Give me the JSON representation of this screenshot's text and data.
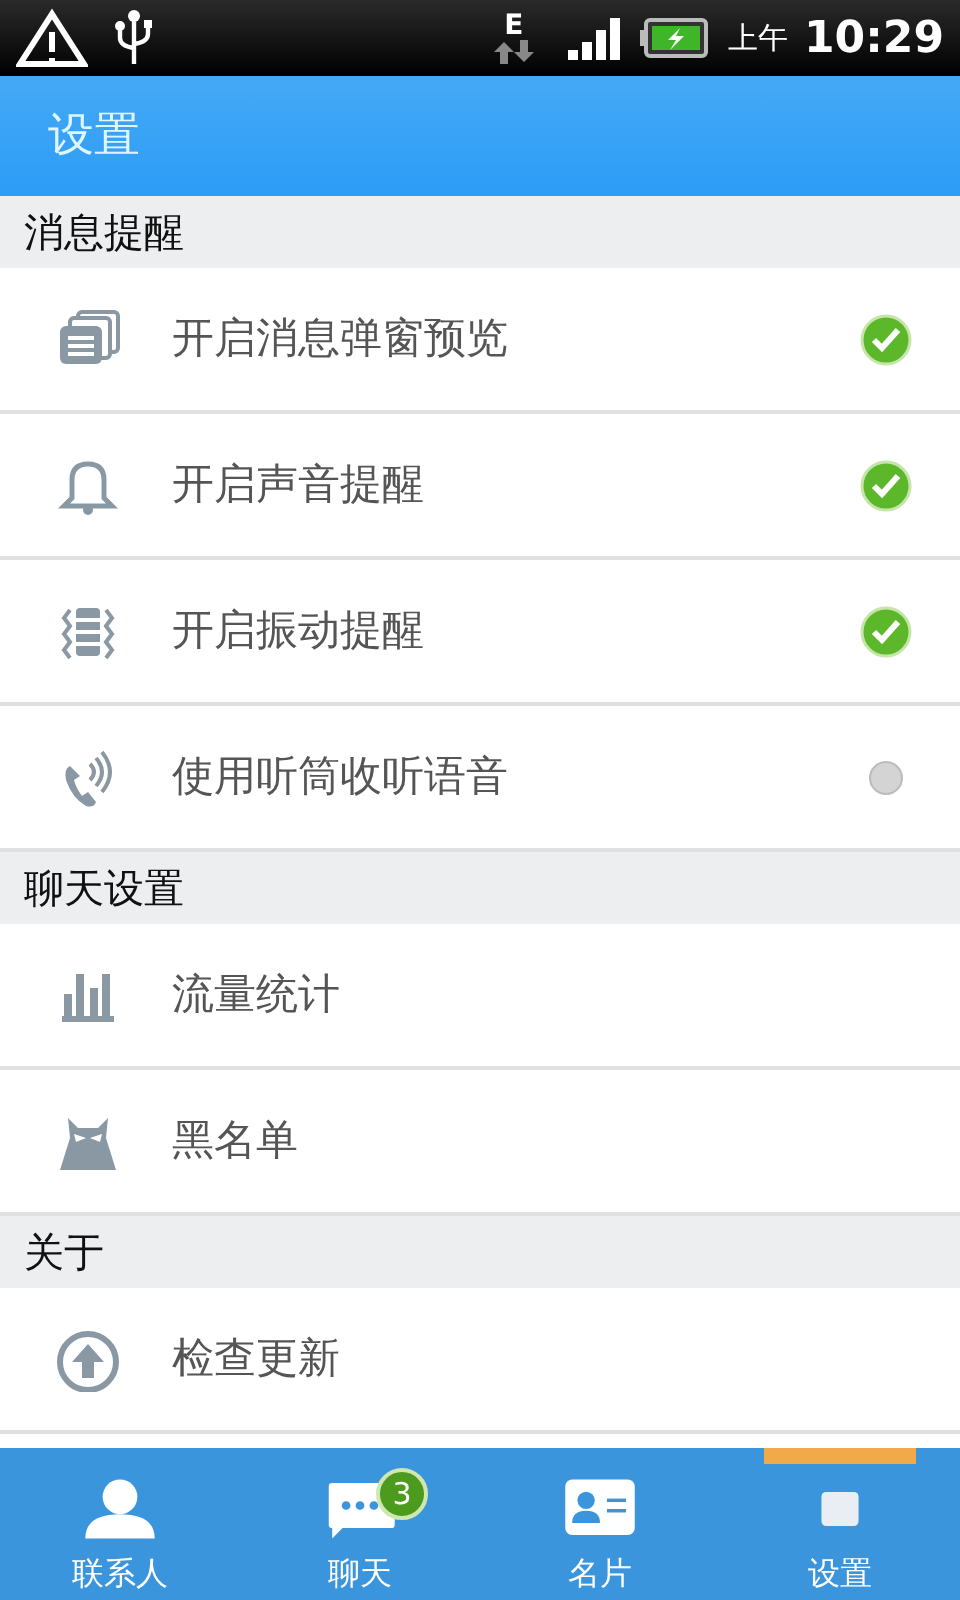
{
  "status_bar": {
    "network": "E",
    "am_pm": "上午",
    "time": "10:29"
  },
  "title_bar": {
    "title": "设置"
  },
  "sections": [
    {
      "header": "消息提醒",
      "items": [
        {
          "label": "开启消息弹窗预览",
          "kind": "toggle",
          "checked": true
        },
        {
          "label": "开启声音提醒",
          "kind": "toggle",
          "checked": true
        },
        {
          "label": "开启振动提醒",
          "kind": "toggle",
          "checked": true
        },
        {
          "label": "使用听筒收听语音",
          "kind": "toggle",
          "checked": false
        }
      ]
    },
    {
      "header": "聊天设置",
      "items": [
        {
          "label": "流量统计",
          "kind": "link"
        },
        {
          "label": "黑名单",
          "kind": "link"
        }
      ]
    },
    {
      "header": "关于",
      "items": [
        {
          "label": "检查更新",
          "kind": "link"
        }
      ]
    }
  ],
  "tabs": [
    {
      "label": "联系人",
      "selected": false
    },
    {
      "label": "聊天",
      "selected": false,
      "badge": "3"
    },
    {
      "label": "名片",
      "selected": false
    },
    {
      "label": "设置",
      "selected": true
    }
  ]
}
